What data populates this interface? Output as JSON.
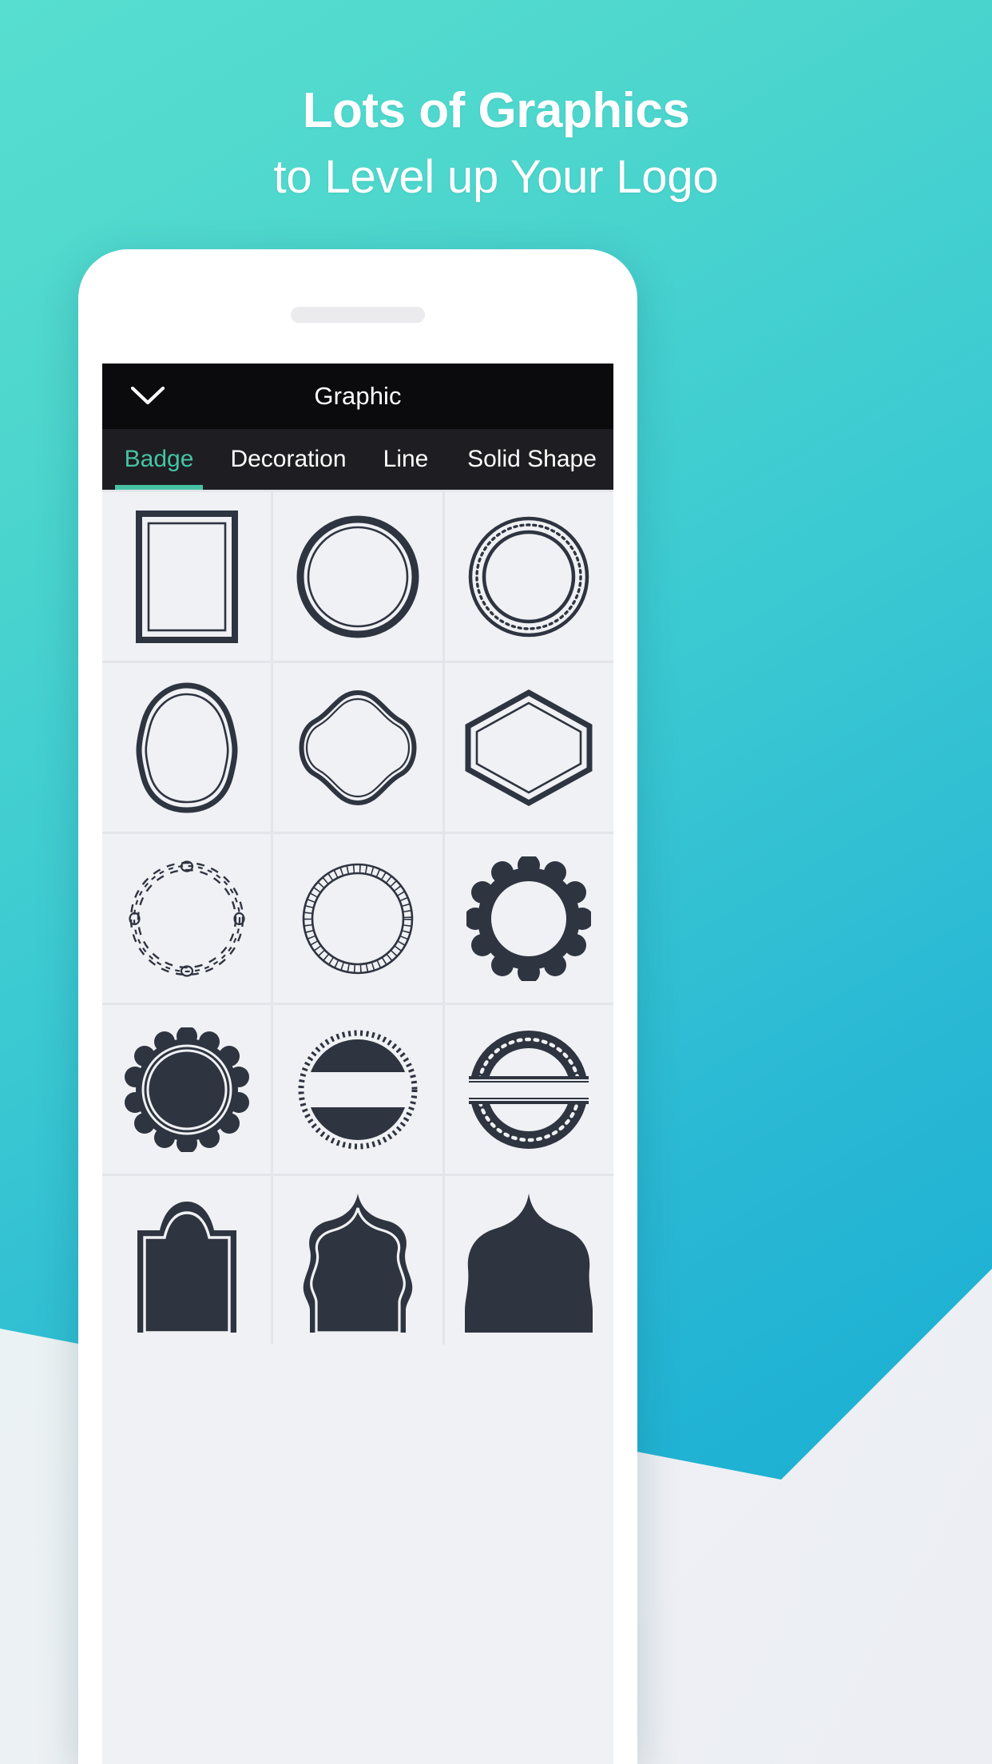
{
  "promo": {
    "headline_line1": "Lots of Graphics",
    "headline_line2": "to Level up Your Logo",
    "background_color_top": "#57ded1",
    "background_color_bottom": "#12a9d2",
    "panel_color": "#edeff4"
  },
  "app": {
    "header": {
      "back_icon": "chevron-down-icon",
      "title": "Graphic",
      "background_color": "#0b0b0d",
      "text_color": "#ffffff"
    },
    "tabs": {
      "active_color": "#46c3a4",
      "inactive_color": "#ffffff",
      "background_color": "#1e1e22",
      "items": [
        {
          "label": "Badge",
          "active": true
        },
        {
          "label": "Decoration",
          "active": false
        },
        {
          "label": "Line",
          "active": false
        },
        {
          "label": "Solid Shape",
          "active": false
        }
      ]
    },
    "grid": {
      "columns": 3,
      "cell_background": "#f0f1f4",
      "shape_color": "#2e3440",
      "items": [
        {
          "name": "double-line-rectangle-badge"
        },
        {
          "name": "double-ring-circle-badge"
        },
        {
          "name": "dotted-double-ring-circle-badge"
        },
        {
          "name": "rounded-hexagon-outline-badge"
        },
        {
          "name": "wavy-blob-outline-badge"
        },
        {
          "name": "hexagon-double-outline-badge"
        },
        {
          "name": "braided-guilloche-circle-badge"
        },
        {
          "name": "rope-circle-badge"
        },
        {
          "name": "solid-scalloped-ring-badge"
        },
        {
          "name": "solid-scalloped-seal-badge"
        },
        {
          "name": "split-banner-dashed-circle-badge"
        },
        {
          "name": "split-dotted-ring-badge"
        },
        {
          "name": "arched-plaque-badge"
        },
        {
          "name": "ornate-baroque-shield-badge"
        },
        {
          "name": "rounded-crest-badge"
        }
      ]
    }
  }
}
